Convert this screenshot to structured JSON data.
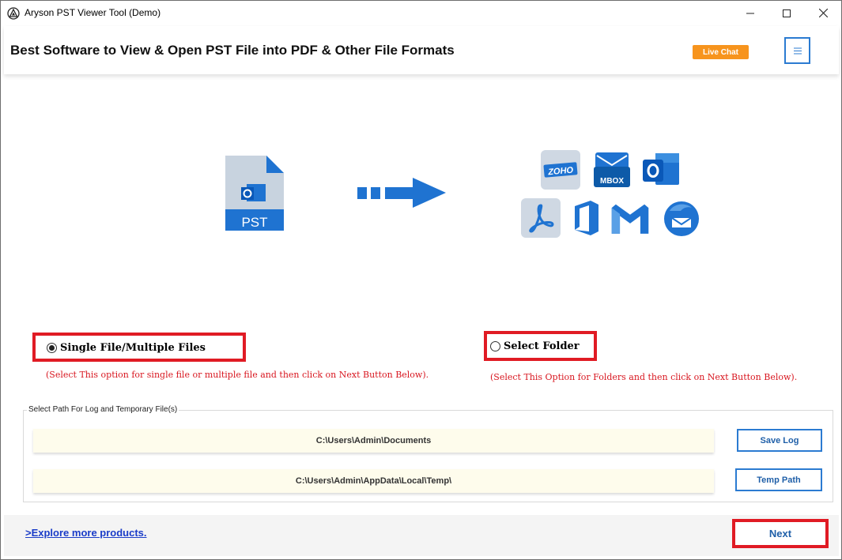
{
  "window": {
    "title": "Aryson PST Viewer Tool (Demo)",
    "controls": {
      "minimize": "—",
      "maximize": "☐",
      "close": "✕"
    }
  },
  "header": {
    "title": "Best Software to View & Open PST File into PDF & Other File Formats",
    "live_chat_label": "Live Chat",
    "menu_icon": "hamburger-icon"
  },
  "illustration": {
    "source_label": "PST",
    "source_icon": "outlook-icon",
    "target_icons": [
      "zoho-icon",
      "mbox-icon",
      "outlook-icon",
      "pdf-icon",
      "office365-icon",
      "gmail-icon",
      "thunderbird-icon"
    ],
    "mbox_label": "MBOX",
    "zoho_label": "ZOHO"
  },
  "options": {
    "single": {
      "label": "Single File/Multiple Files",
      "selected": true,
      "hint": "(Select This option for single file or multiple file and then click on Next Button Below)."
    },
    "folder": {
      "label": "Select Folder",
      "selected": false,
      "hint": "(Select This Option for Folders and then click on Next Button Below)."
    }
  },
  "paths": {
    "legend": "Select Path For Log and Temporary File(s)",
    "log_path": "C:\\Users\\Admin\\Documents",
    "temp_path": "C:\\Users\\Admin\\AppData\\Local\\Temp\\",
    "save_log_label": "Save Log",
    "temp_path_label": "Temp Path"
  },
  "footer": {
    "explore_label": ">Explore more products.",
    "next_label": "Next"
  },
  "colors": {
    "accent_blue": "#1f73d1",
    "highlight_red": "#e01b24",
    "live_chat_orange": "#f7941d",
    "hint_red": "#d8161f"
  }
}
